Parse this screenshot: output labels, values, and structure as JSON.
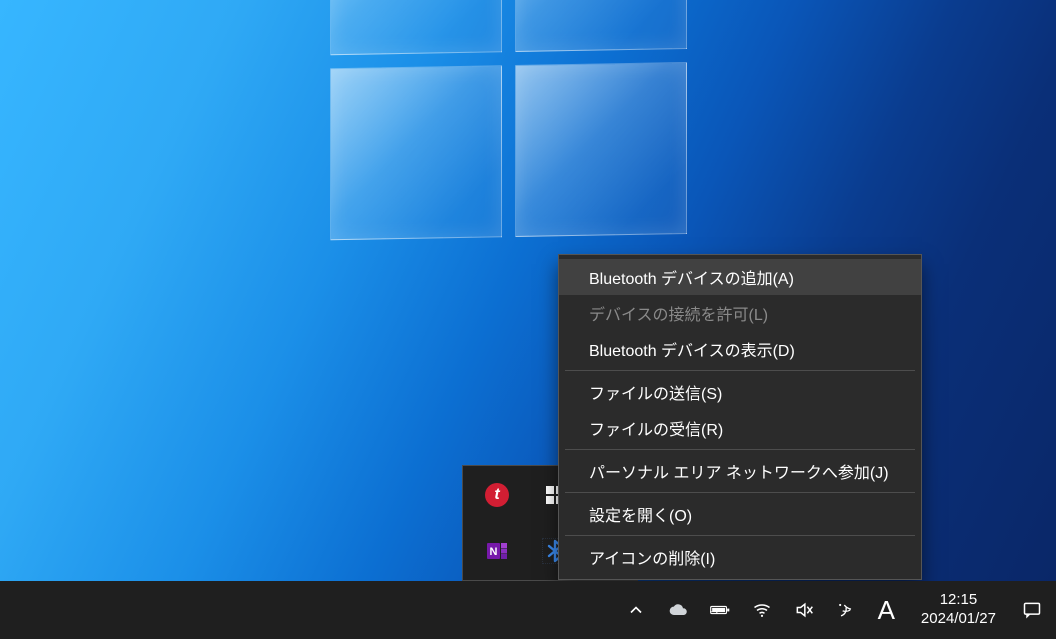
{
  "desktop": {},
  "tray_popup": {
    "icons": [
      {
        "name": "trend-icon"
      },
      {
        "name": "defender-update-icon"
      },
      {
        "name": "onenote-icon"
      },
      {
        "name": "bluetooth-icon"
      },
      {
        "name": "security-shield-icon"
      }
    ]
  },
  "context_menu": {
    "items": [
      {
        "label": "Bluetooth デバイスの追加(A)",
        "enabled": true,
        "highlight": true
      },
      {
        "label": "デバイスの接続を許可(L)",
        "enabled": false,
        "highlight": false
      },
      {
        "label": "Bluetooth デバイスの表示(D)",
        "enabled": true,
        "highlight": false
      },
      {
        "sep": true
      },
      {
        "label": "ファイルの送信(S)",
        "enabled": true,
        "highlight": false
      },
      {
        "label": "ファイルの受信(R)",
        "enabled": true,
        "highlight": false
      },
      {
        "sep": true
      },
      {
        "label": "パーソナル エリア ネットワークへ参加(J)",
        "enabled": true,
        "highlight": false
      },
      {
        "sep": true
      },
      {
        "label": "設定を開く(O)",
        "enabled": true,
        "highlight": false
      },
      {
        "sep": true
      },
      {
        "label": "アイコンの削除(I)",
        "enabled": true,
        "highlight": false
      }
    ]
  },
  "taskbar": {
    "ime": "A",
    "clock_time": "12:15",
    "clock_date": "2024/01/27"
  }
}
